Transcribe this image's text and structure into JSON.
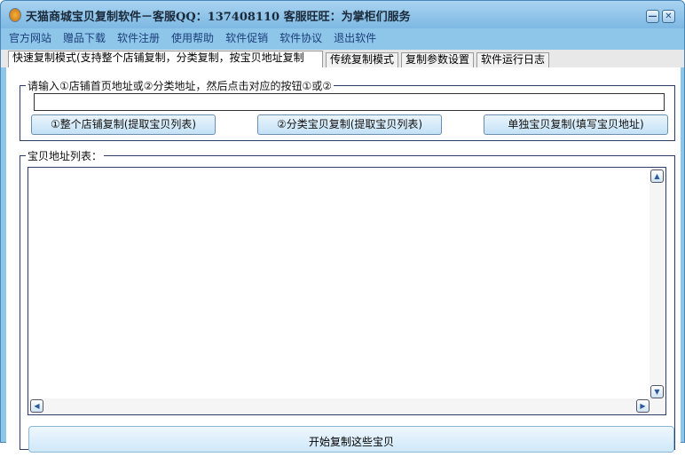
{
  "window": {
    "title": "天猫商城宝贝复制软件－客服QQ：137408110 客服旺旺：为掌柜们服务",
    "minimize": "—",
    "close": "✕"
  },
  "menu": [
    "官方网站",
    "赠品下载",
    "软件注册",
    "使用帮助",
    "软件促销",
    "软件协议",
    "退出软件"
  ],
  "tabs": [
    "快速复制模式(支持整个店铺复制，分类复制，按宝贝地址复制",
    "传统复制模式",
    "复制参数设置",
    "软件运行日志"
  ],
  "input_group": {
    "legend": "请输入①店铺首页地址或②分类地址，然后点击对应的按钮①或②",
    "value": ""
  },
  "buttons": {
    "shop": "①整个店铺复制(提取宝贝列表)",
    "category": "②分类宝贝复制(提取宝贝列表)",
    "single": "单独宝贝复制(填写宝贝地址)",
    "start": "开始复制这些宝贝"
  },
  "list_group": {
    "legend": "宝贝地址列表："
  },
  "scroll": {
    "up": "▲",
    "down": "▼",
    "left": "◀",
    "right": "▶"
  }
}
